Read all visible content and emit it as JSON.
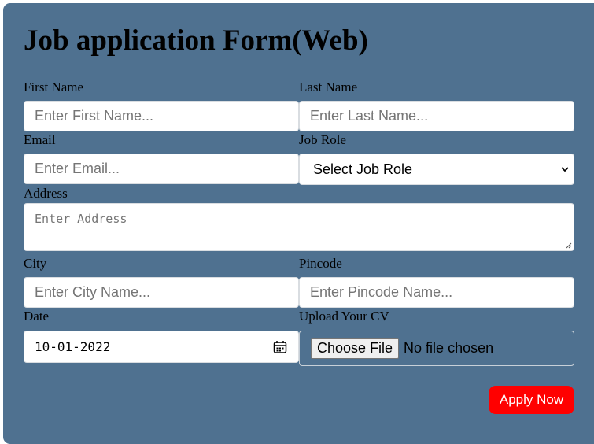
{
  "form": {
    "title": "Job application Form(Web)",
    "first_name": {
      "label": "First Name",
      "placeholder": "Enter First Name..."
    },
    "last_name": {
      "label": "Last Name",
      "placeholder": "Enter Last Name..."
    },
    "email": {
      "label": "Email",
      "placeholder": "Enter Email..."
    },
    "job_role": {
      "label": "Job Role",
      "selected": "Select Job Role"
    },
    "address": {
      "label": "Address",
      "placeholder": "Enter Address"
    },
    "city": {
      "label": "City",
      "placeholder": "Enter City Name..."
    },
    "pincode": {
      "label": "Pincode",
      "placeholder": "Enter Pincode Name..."
    },
    "date": {
      "label": "Date",
      "value": "10-01-2022"
    },
    "cv": {
      "label": "Upload Your CV",
      "button": "Choose File",
      "status": "No file chosen"
    },
    "submit_label": "Apply Now"
  },
  "colors": {
    "card_bg": "#4f7190",
    "submit_bg": "#ff0000",
    "submit_text": "#ffffff"
  }
}
